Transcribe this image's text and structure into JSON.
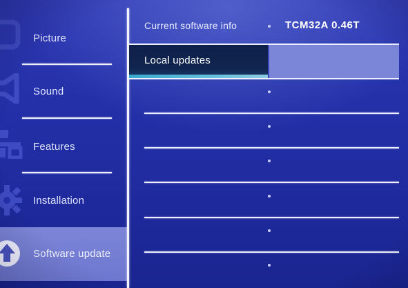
{
  "sidebar": {
    "items": [
      {
        "label": "Picture",
        "icon": "picture-icon"
      },
      {
        "label": "Sound",
        "icon": "speaker-icon"
      },
      {
        "label": "Features",
        "icon": "features-icon"
      },
      {
        "label": "Installation",
        "icon": "gear-icon"
      },
      {
        "label": "Software update",
        "icon": "software-update-icon",
        "selected": true
      }
    ]
  },
  "panel": {
    "current_software": {
      "label": "Current software info",
      "value": "TCM32A 0.46T"
    },
    "local_updates": {
      "label": "Local updates",
      "selected": true
    },
    "empty_rows": 6
  },
  "colors": {
    "background": "#2430a8",
    "selected_sidebar": "#7c85d6",
    "selected_row": "#10254f",
    "value_box": "#7b86d9",
    "separator": "#eef0ff"
  }
}
